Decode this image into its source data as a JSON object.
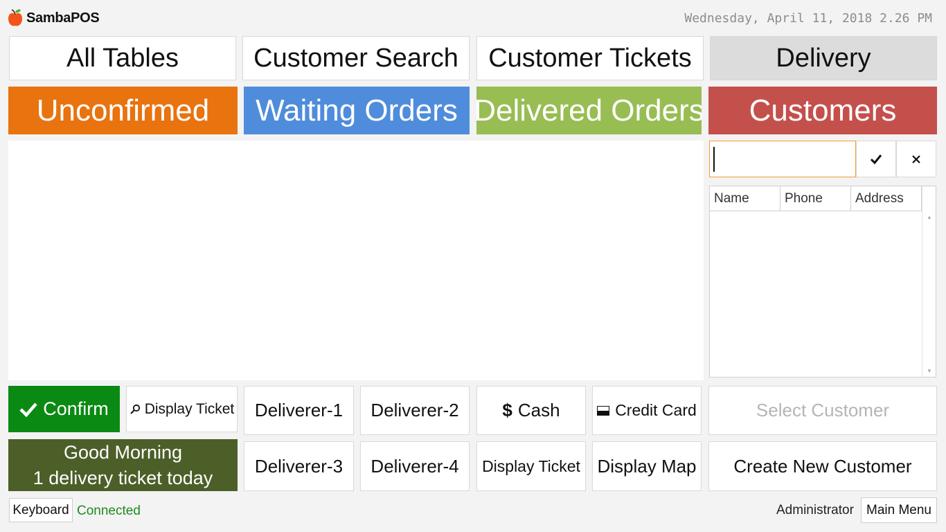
{
  "app": {
    "name": "SambaPOS",
    "datetime": "Wednesday, April 11, 2018 2.26 PM"
  },
  "nav": {
    "all_tables": "All Tables",
    "customer_search": "Customer Search",
    "customer_tickets": "Customer Tickets",
    "delivery": "Delivery"
  },
  "categories": {
    "unconfirmed": "Unconfirmed",
    "waiting_orders": "Waiting Orders",
    "delivered_orders": "Delivered Orders",
    "customers": "Customers"
  },
  "colors": {
    "unconfirmed": "#e8730f",
    "waiting_orders": "#4f8cdb",
    "delivered_orders": "#98bd53",
    "customers": "#c4504c",
    "confirm": "#0a8a13",
    "greeting": "#4c5f29"
  },
  "search": {
    "value": "",
    "placeholder": "",
    "accept_icon": "check-icon",
    "clear_icon": "close-icon"
  },
  "customer_table": {
    "columns": [
      "Name",
      "Phone",
      "Address"
    ],
    "rows": []
  },
  "actions": {
    "confirm": "Confirm",
    "display_ticket_1": "Display Ticket",
    "deliverer_1": "Deliverer-1",
    "deliverer_2": "Deliverer-2",
    "cash": "Cash",
    "credit_card": "Credit Card",
    "select_customer": "Select Customer",
    "deliverer_3": "Deliverer-3",
    "deliverer_4": "Deliverer-4",
    "display_ticket_2": "Display Ticket",
    "display_map": "Display Map",
    "create_new_customer": "Create New Customer"
  },
  "greeting": {
    "line1": "Good Morning",
    "line2": "1 delivery ticket today"
  },
  "footer": {
    "keyboard": "Keyboard",
    "status": "Connected",
    "user": "Administrator",
    "main_menu": "Main Menu"
  }
}
